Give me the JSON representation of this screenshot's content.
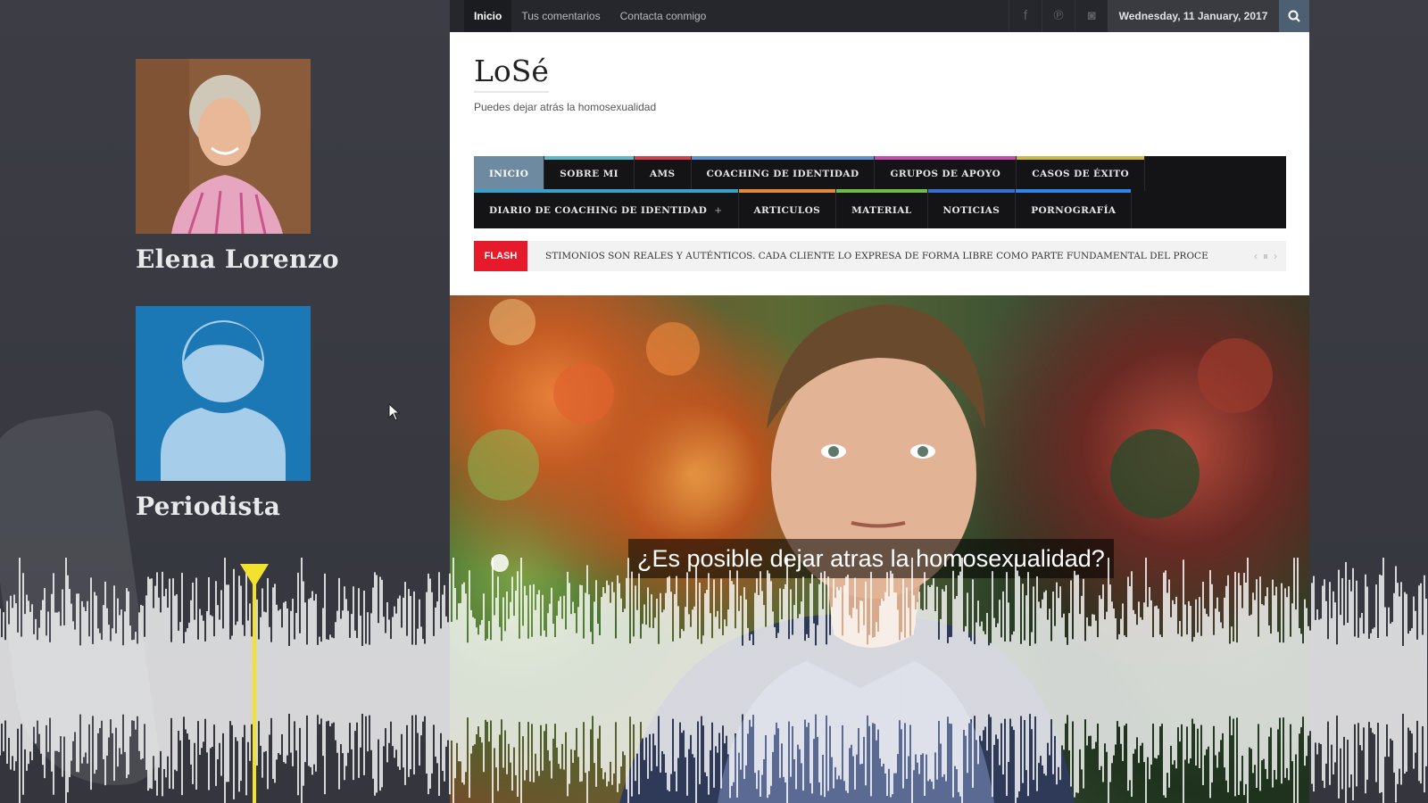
{
  "speakers": [
    {
      "name": "Elena Lorenzo",
      "photo": "woman-portrait"
    },
    {
      "name": "Periodista",
      "photo": "generic-avatar-icon"
    }
  ],
  "browser": {
    "topbar": {
      "links": [
        "Inicio",
        "Tus comentarios",
        "Contacta conmigo"
      ],
      "social_icons": [
        "facebook-icon",
        "pinterest-icon",
        "instagram-icon"
      ],
      "date": "Wednesday, 11 January, 2017",
      "search_icon": "search-icon"
    },
    "site": {
      "title": "LoSé",
      "tagline": "Puedes dejar atrás la homosexualidad"
    },
    "nav_row1": [
      {
        "label": "INICIO",
        "color": "#6d8aa1"
      },
      {
        "label": "SOBRE MI",
        "color": "#5fb8c8"
      },
      {
        "label": "AMS",
        "color": "#d3424a"
      },
      {
        "label": "COACHING DE IDENTIDAD",
        "color": "#5e8fce"
      },
      {
        "label": "GRUPOS DE APOYO",
        "color": "#c24fb0"
      },
      {
        "label": "CASOS DE ÉXITO",
        "color": "#c9b84a"
      }
    ],
    "nav_row2": [
      {
        "label": "DIARIO DE COACHING DE IDENTIDAD",
        "color": "#3aa0c8",
        "has_submenu": true
      },
      {
        "label": "ARTICULOS",
        "color": "#e08a3a"
      },
      {
        "label": "MATERIAL",
        "color": "#6dbb4a"
      },
      {
        "label": "NOTICIAS",
        "color": "#3a6fd0"
      },
      {
        "label": "PORNOGRAFÍA",
        "color": "#2f86e8"
      }
    ],
    "nav_submenu_symbol": "+",
    "flash": {
      "label": "FLASH",
      "text": "STIMONIOS SON REALES Y AUTÉNTICOS. CADA CLIENTE LO EXPRESA DE FORMA LIBRE COMO PARTE FUNDAMENTAL DEL PROCE"
    },
    "hero": {
      "caption": "¿Es posible dejar atras la homosexualidad?"
    }
  },
  "colors": {
    "playhead": "#f2e22e",
    "flash": "#e51a2a"
  }
}
